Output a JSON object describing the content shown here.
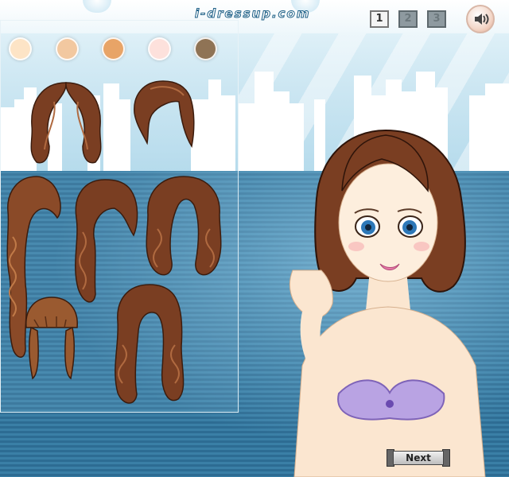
{
  "site_logo": "i-dressup.com",
  "pages": [
    {
      "label": "1",
      "active": true
    },
    {
      "label": "2",
      "active": false
    },
    {
      "label": "3",
      "active": false
    }
  ],
  "sound_icon": "speaker-icon",
  "skin_tones": [
    "#fde4c6",
    "#f2c8a0",
    "#e8a467",
    "#fde1dc",
    "#8f7355"
  ],
  "hair_colors": {
    "dark_brown": "#7a3e22",
    "auburn": "#8a4a28",
    "light_brown": "#9a5a30"
  },
  "hairstyles": [
    "hairstyle-long-wavy",
    "hairstyle-short-bob",
    "hairstyle-long-curly-side",
    "hairstyle-medium-wavy",
    "hairstyle-full-curls",
    "hairstyle-bangs-ponytails",
    "hairstyle-long-waves"
  ],
  "next_label": "Next"
}
